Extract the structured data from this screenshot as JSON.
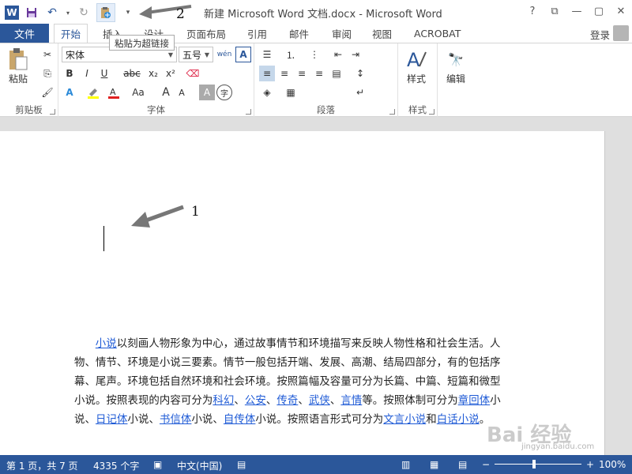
{
  "window": {
    "title": "新建 Microsoft Word 文档.docx - Microsoft Word",
    "controls": [
      "?",
      "⧉",
      "—",
      "▢",
      "✕"
    ]
  },
  "qat": {
    "tooltip": "粘贴为超链接",
    "annotation_2": "2"
  },
  "tabs": {
    "file": "文件",
    "items": [
      "开始",
      "插入",
      "设计",
      "页面布局",
      "引用",
      "邮件",
      "审阅",
      "视图",
      "ACROBAT"
    ],
    "login": "登录"
  },
  "ribbon": {
    "clipboard": {
      "label": "剪贴板",
      "paste": "粘贴"
    },
    "font": {
      "label": "字体",
      "font_name": "宋体",
      "font_size": "五号",
      "bold": "B",
      "italic": "I",
      "underline": "U",
      "strike": "abc",
      "subscript": "x₂",
      "superscript": "x²",
      "grow": "A",
      "shrink": "A",
      "case": "Aa"
    },
    "paragraph": {
      "label": "段落"
    },
    "styles": {
      "label": "样式",
      "button": "样式"
    },
    "editing": {
      "button": "编辑"
    }
  },
  "document": {
    "annotation_1": "1",
    "paragraph": [
      {
        "t": "小说",
        "link": true
      },
      {
        "t": "以刻画人物形象为中心，通过故事情节和环境描写来反映人物性格和社会生活。人物、情节、环境是小说三要素。情节一般包括开端、发展、高潮、结局四部分，有的包括序幕、尾声。环境包括自然环境和社会环境。按照篇幅及容量可分为长篇、中篇、短篇和微型小说。按照表现的内容可分为",
        "link": false
      },
      {
        "t": "科幻",
        "link": true
      },
      {
        "t": "、",
        "link": false
      },
      {
        "t": "公安",
        "link": true
      },
      {
        "t": "、",
        "link": false
      },
      {
        "t": "传奇",
        "link": true
      },
      {
        "t": "、",
        "link": false
      },
      {
        "t": "武侠",
        "link": true
      },
      {
        "t": "、",
        "link": false
      },
      {
        "t": "言情",
        "link": true
      },
      {
        "t": "等。按照体制可分为",
        "link": false
      },
      {
        "t": "章回体",
        "link": true
      },
      {
        "t": "小说、",
        "link": false
      },
      {
        "t": "日记体",
        "link": true
      },
      {
        "t": "小说、",
        "link": false
      },
      {
        "t": "书信体",
        "link": true
      },
      {
        "t": "小说、",
        "link": false
      },
      {
        "t": "自传体",
        "link": true
      },
      {
        "t": "小说。按照语言形式可分为",
        "link": false
      },
      {
        "t": "文言小说",
        "link": true
      },
      {
        "t": "和",
        "link": false
      },
      {
        "t": "白话小说",
        "link": true
      },
      {
        "t": "。",
        "link": false
      }
    ]
  },
  "watermark": {
    "main": "Bai 经验",
    "sub": "jingyan.baidu.com"
  },
  "status": {
    "page": "第 1 页，共 7 页",
    "words": "4335 个字",
    "language": "中文(中国)",
    "zoom": "100%",
    "zoom_fraction": 0.45
  },
  "colors": {
    "accent": "#2b579a",
    "link": "#1f5bd6"
  }
}
